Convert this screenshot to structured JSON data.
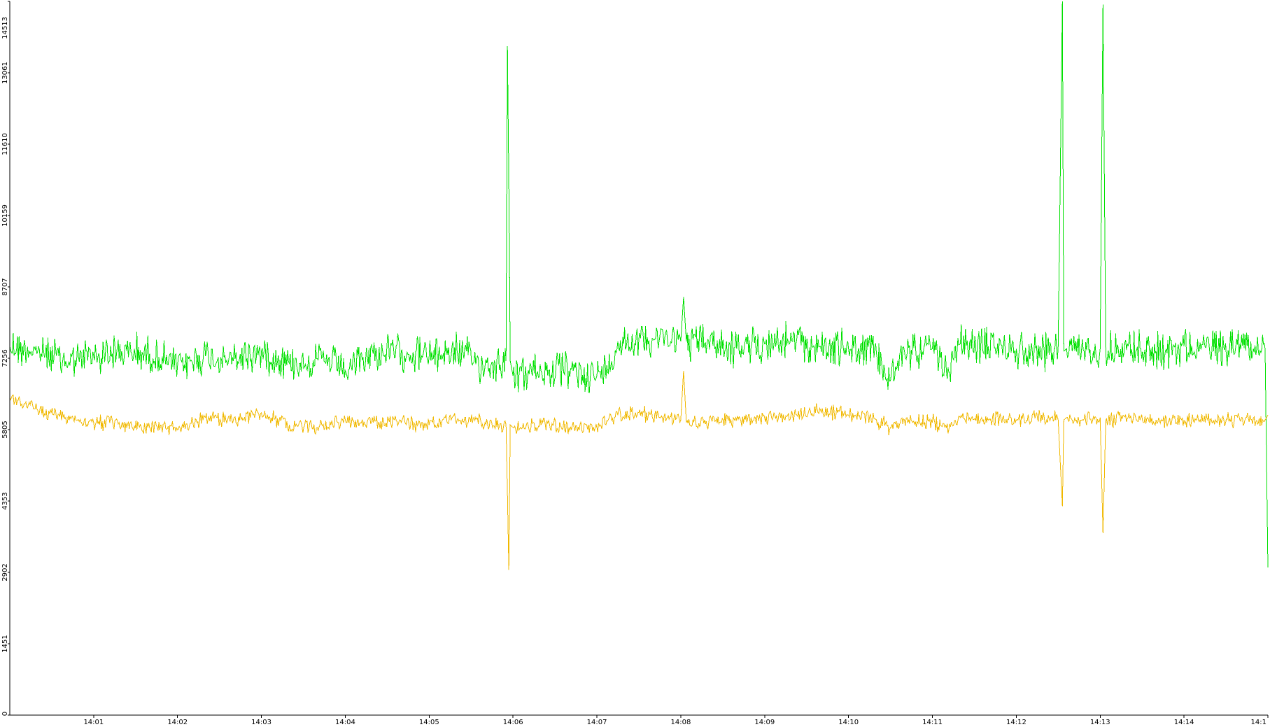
{
  "chart_data": {
    "type": "line",
    "title": "",
    "xlabel": "",
    "ylabel": "",
    "x_unit": "minutes",
    "xlim": [
      14.0,
      14.965
    ],
    "ylim": [
      0,
      14513
    ],
    "y_ticks": [
      0,
      1451,
      2902,
      4353,
      5805,
      7256,
      8707,
      10159,
      11610,
      13061,
      14513
    ],
    "x_ticks": [
      {
        "value": 14.0167,
        "label": "14:01"
      },
      {
        "value": 14.0333,
        "label": "14:02"
      },
      {
        "value": 14.05,
        "label": "14:03"
      },
      {
        "value": 14.0667,
        "label": "14:04"
      },
      {
        "value": 14.0833,
        "label": "14:05"
      },
      {
        "value": 14.1,
        "label": "14:06"
      },
      {
        "value": 14.1167,
        "label": "14:07"
      },
      {
        "value": 14.1333,
        "label": "14:08"
      },
      {
        "value": 14.15,
        "label": "14:09"
      },
      {
        "value": 14.1667,
        "label": "14:10"
      },
      {
        "value": 14.1833,
        "label": "14:11"
      },
      {
        "value": 14.2,
        "label": "14:12"
      },
      {
        "value": 14.2167,
        "label": "14:13"
      },
      {
        "value": 14.2333,
        "label": "14:14"
      },
      {
        "value": 14.25,
        "label": "14:1"
      }
    ],
    "grid": false,
    "legend": "none",
    "series": [
      {
        "color": "#00e000",
        "note_range": "upper series",
        "x": [
          "14:00:00",
          "14:00:20",
          "14:00:40",
          "14:01:00",
          "14:01:20",
          "14:01:40",
          "14:02:00",
          "14:02:20",
          "14:02:40",
          "14:03:00",
          "14:03:20",
          "14:03:40",
          "14:04:00",
          "14:04:20",
          "14:04:40",
          "14:05:00",
          "14:05:20",
          "14:05:40",
          "14:05:55",
          "14:05:56",
          "14:05:57",
          "14:05:58",
          "14:06:00",
          "14:06:20",
          "14:06:40",
          "14:07:00",
          "14:07:10",
          "14:07:15",
          "14:07:30",
          "14:07:45",
          "14:08:00",
          "14:08:02",
          "14:08:04",
          "14:08:20",
          "14:08:40",
          "14:09:00",
          "14:09:20",
          "14:09:40",
          "14:10:00",
          "14:10:20",
          "14:10:30",
          "14:10:40",
          "14:11:00",
          "14:11:10",
          "14:11:20",
          "14:11:40",
          "14:12:00",
          "14:12:20",
          "14:12:30",
          "14:12:33",
          "14:12:34",
          "14:12:36",
          "14:12:40",
          "14:13:00",
          "14:13:02",
          "14:13:04",
          "14:13:20",
          "14:13:40",
          "14:14:00",
          "14:14:20",
          "14:14:40",
          "14:14:58",
          "14:15:00"
        ],
        "y": [
          7500,
          7400,
          7200,
          7300,
          7400,
          7350,
          7100,
          7300,
          7200,
          7400,
          7150,
          7250,
          7000,
          7350,
          7400,
          7300,
          7400,
          7100,
          7200,
          13600,
          10800,
          7200,
          6900,
          7000,
          7000,
          6900,
          7100,
          7600,
          7650,
          7700,
          7600,
          8500,
          7600,
          7600,
          7450,
          7550,
          7600,
          7500,
          7450,
          7350,
          6800,
          7400,
          7450,
          7000,
          7550,
          7500,
          7450,
          7400,
          7500,
          14513,
          7400,
          7450,
          7400,
          7450,
          14450,
          7400,
          7500,
          7400,
          7500,
          7450,
          7550,
          7450,
          3000
        ]
      },
      {
        "color": "#f0b800",
        "note_range": "lower series",
        "x": [
          "14:00:00",
          "14:00:20",
          "14:00:40",
          "14:01:00",
          "14:01:20",
          "14:01:40",
          "14:02:00",
          "14:02:20",
          "14:02:40",
          "14:03:00",
          "14:03:20",
          "14:03:40",
          "14:04:00",
          "14:04:20",
          "14:04:40",
          "14:05:00",
          "14:05:20",
          "14:05:40",
          "14:05:55",
          "14:05:56",
          "14:05:57",
          "14:05:58",
          "14:06:00",
          "14:06:20",
          "14:06:40",
          "14:07:00",
          "14:07:10",
          "14:07:15",
          "14:07:30",
          "14:07:45",
          "14:08:00",
          "14:08:02",
          "14:08:04",
          "14:08:20",
          "14:08:40",
          "14:09:00",
          "14:09:20",
          "14:09:40",
          "14:10:00",
          "14:10:20",
          "14:10:30",
          "14:10:40",
          "14:11:00",
          "14:11:10",
          "14:11:20",
          "14:11:40",
          "14:12:00",
          "14:12:20",
          "14:12:30",
          "14:12:33",
          "14:12:34",
          "14:12:36",
          "14:12:40",
          "14:13:00",
          "14:13:02",
          "14:13:04",
          "14:13:20",
          "14:13:40",
          "14:14:00",
          "14:14:20",
          "14:14:40",
          "14:14:58",
          "14:15:00"
        ],
        "y": [
          6450,
          6200,
          6050,
          5950,
          5900,
          5850,
          5800,
          6050,
          6000,
          6150,
          5900,
          5850,
          6000,
          5950,
          5950,
          5900,
          6000,
          5950,
          5900,
          4500,
          2950,
          5900,
          5850,
          5900,
          5850,
          5850,
          6100,
          6100,
          6150,
          6050,
          6000,
          7000,
          5950,
          5950,
          6000,
          6050,
          6100,
          6200,
          6100,
          6000,
          5850,
          6000,
          5950,
          5850,
          6050,
          6000,
          6000,
          6050,
          6000,
          4250,
          6000,
          6050,
          6000,
          6050,
          3700,
          6000,
          6050,
          6000,
          6000,
          5950,
          6000,
          6000,
          6100
        ]
      }
    ]
  }
}
